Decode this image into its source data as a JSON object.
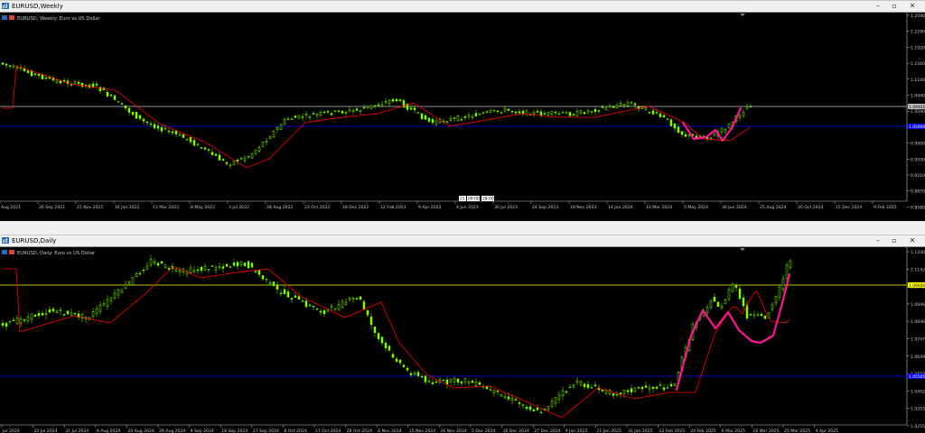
{
  "windows": [
    {
      "title": "EURUSD,Weekly",
      "chart_label": "EURUSD, Weekly: Euro vs US Dollar",
      "price_ticks": [
        "1.25900",
        "1.22900",
        "1.19200",
        "1.15600",
        "1.12400",
        "1.09400",
        "1.05900",
        "1.02900",
        "0.99000",
        "0.95500",
        "0.92100",
        "0.88700",
        "0.85800"
      ],
      "date_ticks": [
        "Aug 2021",
        "26 Sep 2021",
        "21 Nov 2021",
        "16 Jan 2022",
        "13 Mar 2022",
        "8 May 2022",
        "3 Jul 2022",
        "28 Aug 2022",
        "23 Oct 2022",
        "18 Dec 2022",
        "12 Feb 2023",
        "9 Apr 2023",
        "4 Jun 2023",
        "30 Jul 2023",
        "24 Sep 2023",
        "19 Nov 2023",
        "14 Jan 2024",
        "10 Mar 2024",
        "5 May 2024",
        "30 Jun 2024",
        "25 Aug 2024",
        "20 Oct 2024",
        "15 Dec 2024",
        "9 Feb 2025"
      ],
      "highlight_price": "1.09402",
      "blue_line_price": "1.05900",
      "crosshair_labels": [
        "21",
        "09:00",
        "28:00"
      ]
    },
    {
      "title": "EURUSD,Daily",
      "chart_label": "EURUSD, Daily: Euro vs US Dollar",
      "price_ticks": [
        "1.12405",
        "1.11420",
        "1.10435",
        "1.09460",
        "1.08460",
        "1.07475",
        "1.06490",
        "1.05505",
        "1.04520",
        "1.03535",
        "1.02550"
      ],
      "date_ticks": [
        "Jul 2024",
        "22 Jul 2024",
        "31 Jul 2024",
        "9 Aug 2024",
        "20 Aug 2024",
        "29 Aug 2024",
        "9 Sep 2024",
        "18 Sep 2024",
        "27 Sep 2024",
        "8 Oct 2024",
        "17 Oct 2024",
        "28 Oct 2024",
        "6 Nov 2024",
        "15 Nov 2024",
        "26 Nov 2024",
        "5 Dec 2024",
        "16 Dec 2024",
        "27 Dec 2024",
        "9 Jan 2025",
        "21 Jan 2025",
        "31 Jan 2025",
        "12 Feb 2025",
        "24 Feb 2025",
        "6 Mar 2025",
        "16 Mar 2025",
        "25 Mar 2025",
        "4 Apr 2025"
      ],
      "highlight_price": "1.09460",
      "blue_line_price": "1.05505"
    }
  ],
  "colors": {
    "background": "#000000",
    "bull": "#7fff00",
    "ma": "#ff0000",
    "pattern": "#ff1493",
    "blue_line": "#0000ff",
    "hline_weekly": "#c0c0c0",
    "hline_daily": "#ffff00"
  }
}
